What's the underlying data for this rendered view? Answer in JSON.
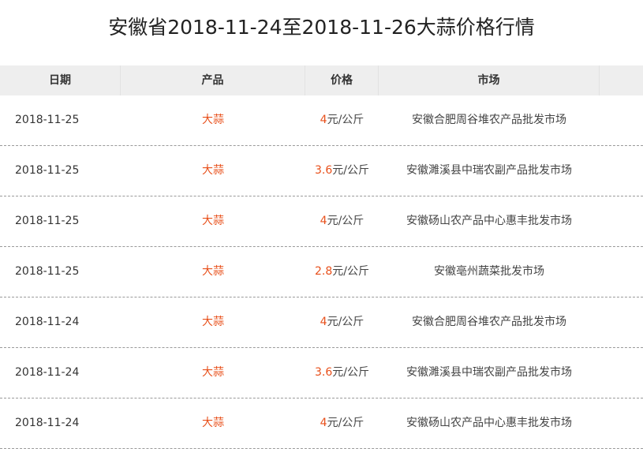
{
  "title": "安徽省2018-11-24至2018-11-26大蒜价格行情",
  "columns": [
    "日期",
    "产品",
    "价格",
    "市场",
    ""
  ],
  "rows": [
    {
      "date": "2018-11-25",
      "product": "大蒜",
      "price": "4",
      "unit": "元/公斤",
      "market": "安徽合肥周谷堆农产品批发市场"
    },
    {
      "date": "2018-11-25",
      "product": "大蒜",
      "price": "3.6",
      "unit": "元/公斤",
      "market": "安徽濉溪县中瑞农副产品批发市场"
    },
    {
      "date": "2018-11-25",
      "product": "大蒜",
      "price": "4",
      "unit": "元/公斤",
      "market": "安徽砀山农产品中心惠丰批发市场"
    },
    {
      "date": "2018-11-25",
      "product": "大蒜",
      "price": "2.8",
      "unit": "元/公斤",
      "market": "安徽亳州蔬菜批发市场"
    },
    {
      "date": "2018-11-24",
      "product": "大蒜",
      "price": "4",
      "unit": "元/公斤",
      "market": "安徽合肥周谷堆农产品批发市场"
    },
    {
      "date": "2018-11-24",
      "product": "大蒜",
      "price": "3.6",
      "unit": "元/公斤",
      "market": "安徽濉溪县中瑞农副产品批发市场"
    },
    {
      "date": "2018-11-24",
      "product": "大蒜",
      "price": "4",
      "unit": "元/公斤",
      "market": "安徽砀山农产品中心惠丰批发市场"
    }
  ],
  "colors": {
    "accent": "#e8501b",
    "header_bg": "#eeeeee"
  }
}
